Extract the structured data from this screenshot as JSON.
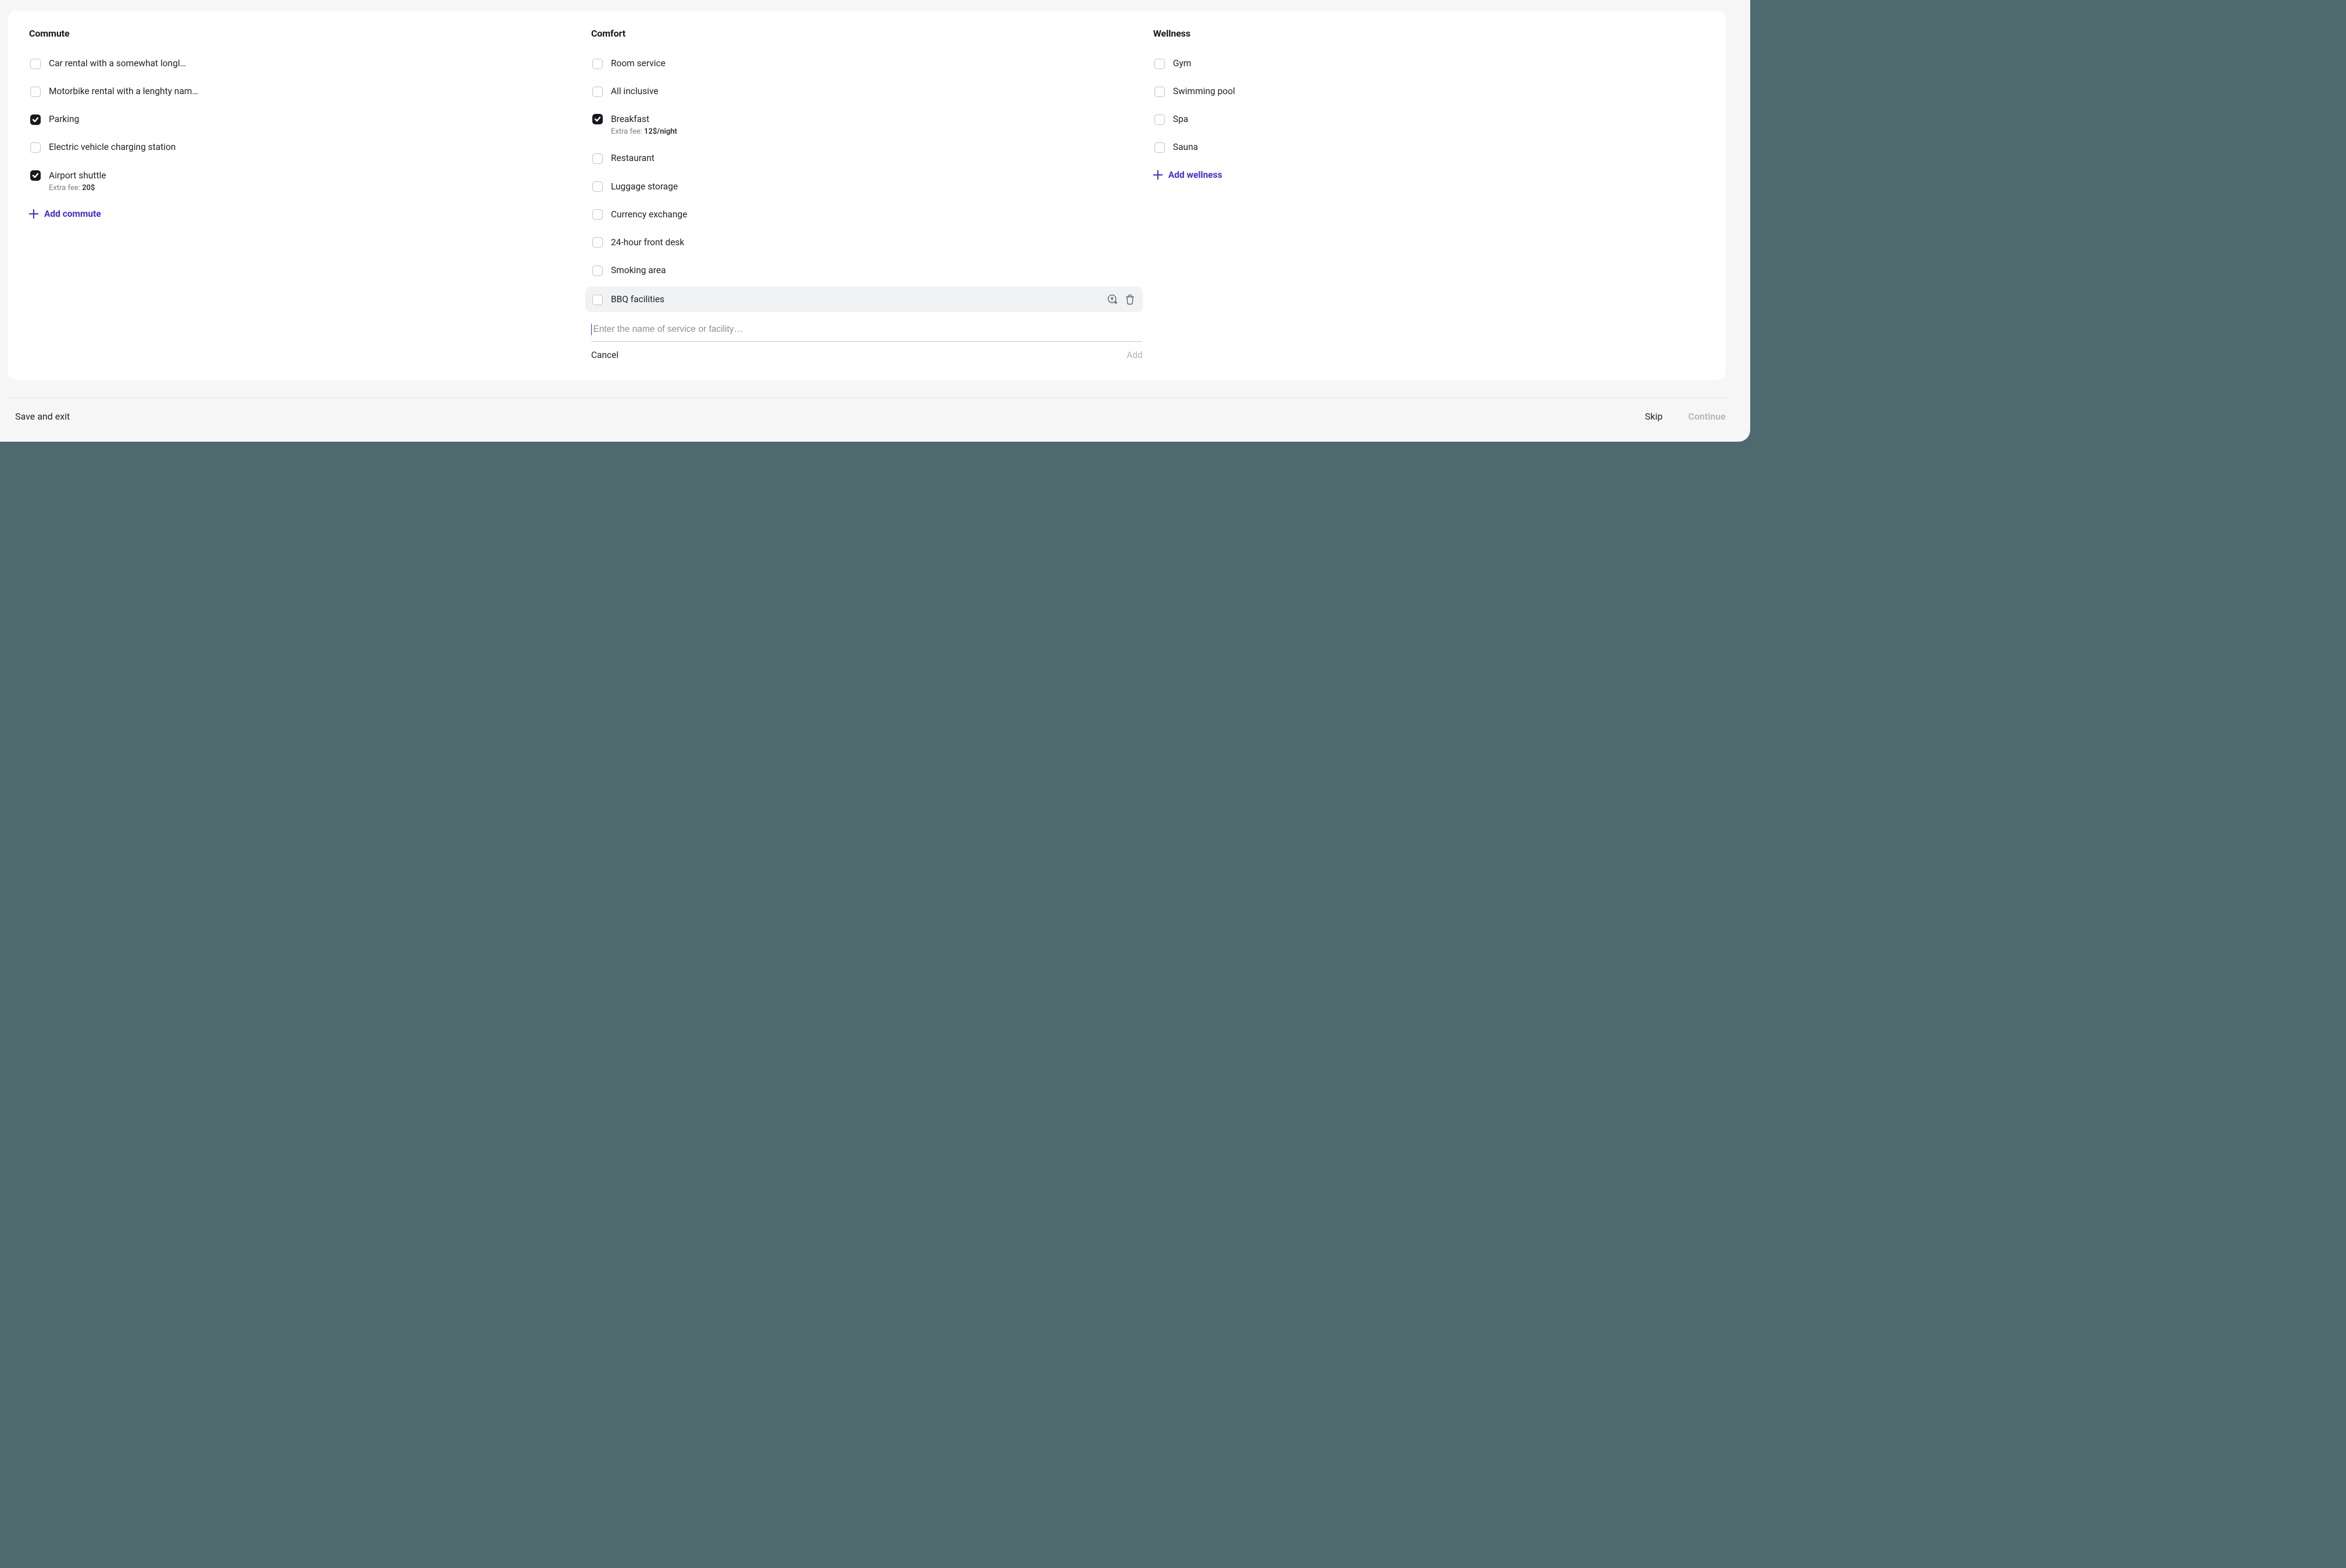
{
  "columns": {
    "commute": {
      "title": "Commute",
      "add_label": "Add commute",
      "items": [
        {
          "label": "Car rental with a somewhat longl…",
          "checked": false
        },
        {
          "label": "Motorbike rental with a lenghty name l…",
          "checked": false
        },
        {
          "label": "Parking",
          "checked": true
        },
        {
          "label": "Electric vehicle charging station",
          "checked": false
        },
        {
          "label": "Airport shuttle",
          "checked": true,
          "sub_prefix": "Extra fee: ",
          "sub_value": "20$"
        }
      ]
    },
    "comfort": {
      "title": "Comfort",
      "items": [
        {
          "label": "Room service",
          "checked": false
        },
        {
          "label": "All inclusive",
          "checked": false
        },
        {
          "label": "Breakfast",
          "checked": true,
          "sub_prefix": "Extra fee: ",
          "sub_value": "12$/night"
        },
        {
          "label": "Restaurant",
          "checked": false
        },
        {
          "label": "Luggage storage",
          "checked": false
        },
        {
          "label": "Currency exchange",
          "checked": false
        },
        {
          "label": "24-hour front desk",
          "checked": false
        },
        {
          "label": "Smoking area",
          "checked": false
        },
        {
          "label": "BBQ facilities",
          "checked": false,
          "hovered": true
        }
      ],
      "new_item": {
        "placeholder": "Enter the name of service or facility…",
        "cancel_label": "Cancel",
        "add_label": "Add"
      }
    },
    "wellness": {
      "title": "Wellness",
      "add_label": "Add wellness",
      "items": [
        {
          "label": "Gym",
          "checked": false
        },
        {
          "label": "Swimming pool",
          "checked": false
        },
        {
          "label": "Spa",
          "checked": false
        },
        {
          "label": "Sauna",
          "checked": false
        }
      ]
    }
  },
  "footer": {
    "save_label": "Save and exit",
    "skip_label": "Skip",
    "continue_label": "Continue"
  }
}
